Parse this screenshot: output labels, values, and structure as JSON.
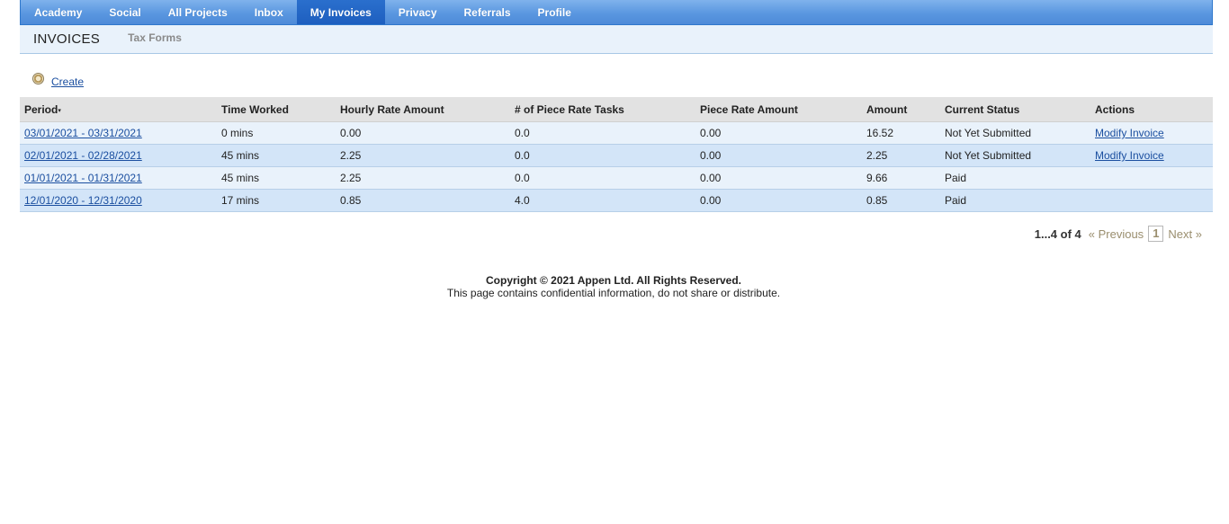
{
  "nav": {
    "items": [
      "Academy",
      "Social",
      "All Projects",
      "Inbox",
      "My Invoices",
      "Privacy",
      "Referrals",
      "Profile"
    ],
    "active": "My Invoices"
  },
  "subheader": {
    "title": "INVOICES",
    "tab": "Tax Forms"
  },
  "create": {
    "label": "Create",
    "icon": "plus-circle-icon"
  },
  "table": {
    "columns": [
      "Period",
      "Time Worked",
      "Hourly Rate Amount",
      "# of Piece Rate Tasks",
      "Piece Rate Amount",
      "Amount",
      "Current Status",
      "Actions"
    ],
    "sort_indicator": "▾",
    "rows": [
      {
        "period": "03/01/2021 - 03/31/2021",
        "time": "0 mins",
        "hourly": "0.00",
        "tasks": "0.0",
        "piece": "0.00",
        "amount": "16.52",
        "status": "Not Yet Submitted",
        "action": "Modify Invoice"
      },
      {
        "period": "02/01/2021 - 02/28/2021",
        "time": "45 mins",
        "hourly": "2.25",
        "tasks": "0.0",
        "piece": "0.00",
        "amount": "2.25",
        "status": "Not Yet Submitted",
        "action": "Modify Invoice"
      },
      {
        "period": "01/01/2021 - 01/31/2021",
        "time": "45 mins",
        "hourly": "2.25",
        "tasks": "0.0",
        "piece": "0.00",
        "amount": "9.66",
        "status": "Paid",
        "action": ""
      },
      {
        "period": "12/01/2020 - 12/31/2020",
        "time": "17 mins",
        "hourly": "0.85",
        "tasks": "4.0",
        "piece": "0.00",
        "amount": "0.85",
        "status": "Paid",
        "action": ""
      }
    ]
  },
  "pager": {
    "count": "1...4 of 4",
    "prev": "« Previous",
    "page": "1",
    "next": "Next »"
  },
  "footer": {
    "copyright": "Copyright © 2021 Appen Ltd. All Rights Reserved.",
    "notice": "This page contains confidential information, do not share or distribute."
  },
  "colors": {
    "nav_blue": "#5a97e0",
    "nav_active": "#1e5fbf",
    "row_light": "#e9f2fb",
    "row_dark": "#d3e5f8",
    "link": "#1b4fa0"
  }
}
